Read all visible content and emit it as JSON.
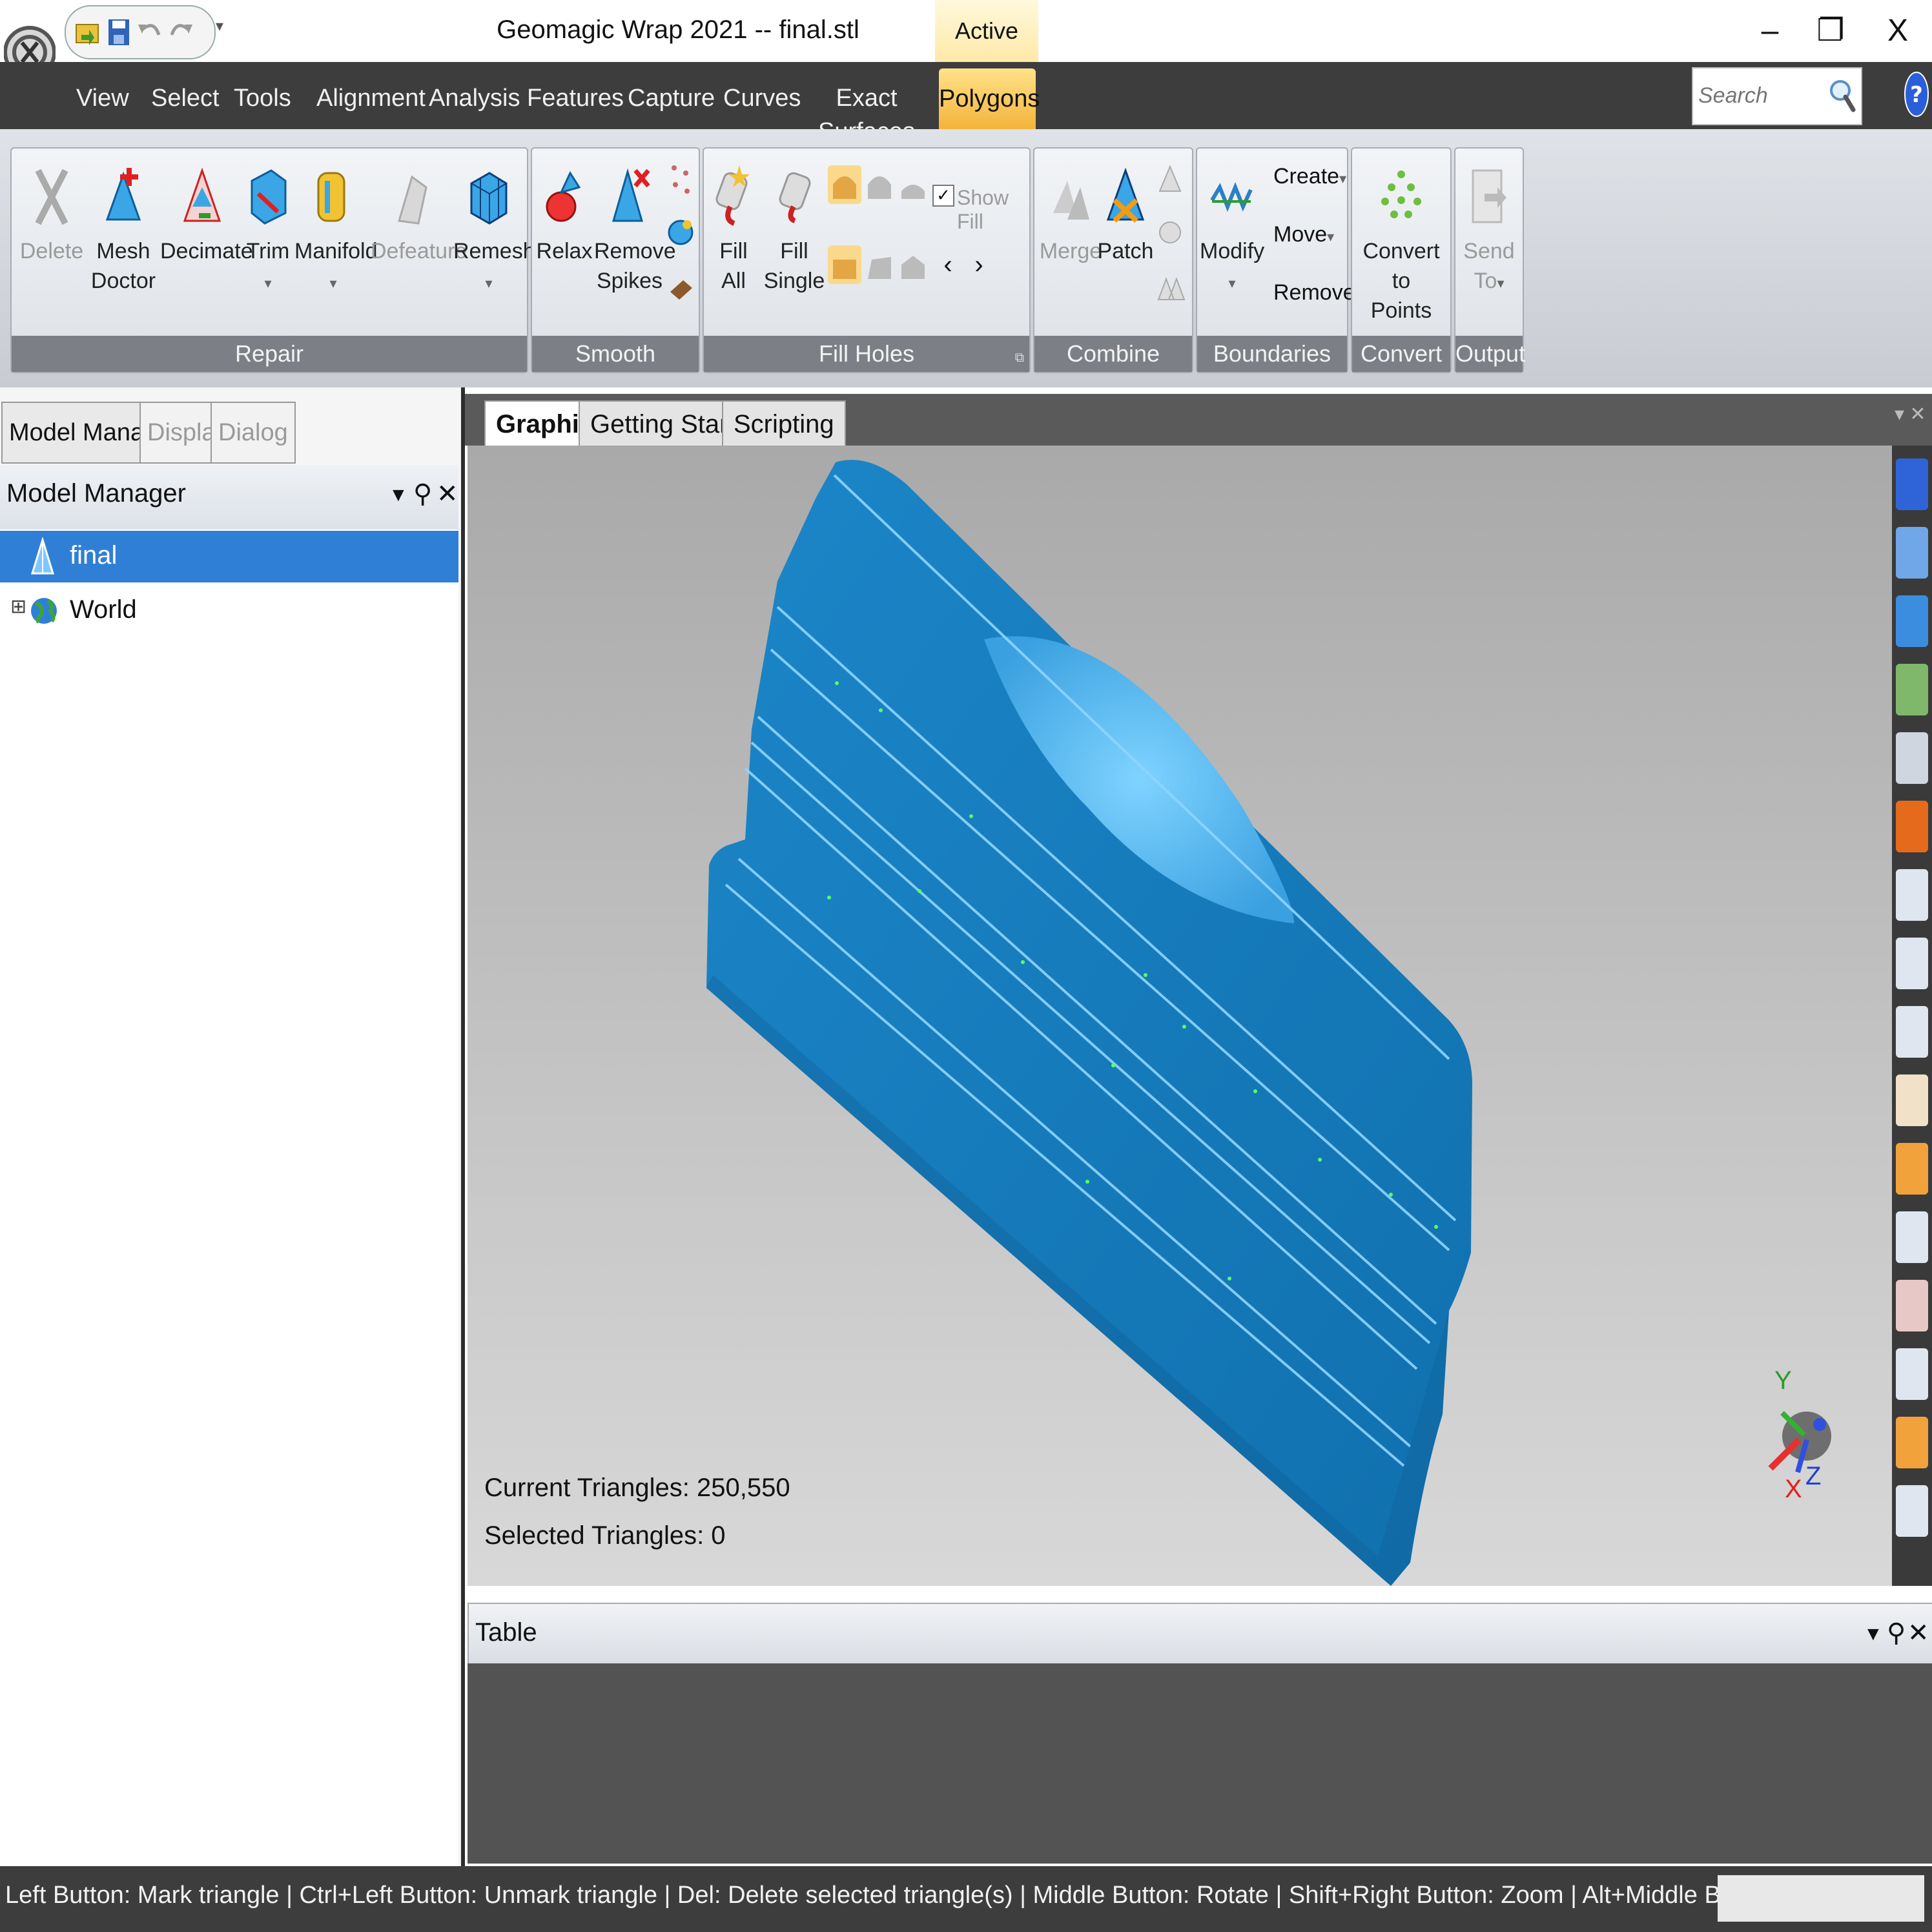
{
  "window": {
    "title": "Geomagic Wrap 2021 -- final.stl",
    "context_label": "Active",
    "minimize": "–",
    "restore": "❐",
    "close": "X"
  },
  "menu": {
    "tabs": [
      "View",
      "Select",
      "Tools",
      "Alignment",
      "Analysis",
      "Features",
      "Capture",
      "Curves",
      "Exact Surfaces",
      "Polygons"
    ],
    "active_tab": "Polygons"
  },
  "search": {
    "placeholder": "Search",
    "value": ""
  },
  "ribbon": {
    "repair": {
      "label": "Repair",
      "delete": "Delete",
      "mesh_doctor_1": "Mesh",
      "mesh_doctor_2": "Doctor",
      "decimate": "Decimate",
      "trim": "Trim",
      "manifold": "Manifold",
      "defeature": "Defeature",
      "remesh": "Remesh"
    },
    "smooth": {
      "label": "Smooth",
      "relax": "Relax",
      "remove_spikes_1": "Remove",
      "remove_spikes_2": "Spikes"
    },
    "fill_holes": {
      "label": "Fill Holes",
      "fill_all_1": "Fill",
      "fill_all_2": "All",
      "fill_single_1": "Fill",
      "fill_single_2": "Single",
      "show_fill": "Show Fill"
    },
    "combine": {
      "label": "Combine",
      "merge": "Merge",
      "patch": "Patch"
    },
    "boundaries": {
      "label": "Boundaries",
      "modify": "Modify",
      "create": "Create",
      "move": "Move",
      "remove": "Remove"
    },
    "convert": {
      "label": "Convert",
      "convert_1": "Convert to",
      "convert_2": "Points"
    },
    "output": {
      "label": "Output",
      "send_1": "Send",
      "send_2": "To"
    }
  },
  "panel": {
    "tabs": [
      "Model Manager",
      "Display",
      "Dialog"
    ],
    "title": "Model Manager",
    "tree": [
      {
        "label": "final",
        "selected": true,
        "icon": "mesh-icon"
      },
      {
        "label": "World",
        "selected": false,
        "icon": "globe-icon",
        "expander": "⊞"
      }
    ]
  },
  "graphics": {
    "tabs": [
      "Graphics",
      "Getting Started",
      "Scripting"
    ],
    "current_triangles": "Current Triangles: 250,550",
    "selected_triangles": "Selected Triangles: 0",
    "axes": {
      "x": "X",
      "y": "Y",
      "z": "Z"
    }
  },
  "table": {
    "title": "Table"
  },
  "status": {
    "text": "Left Button: Mark triangle | Ctrl+Left Button: Unmark triangle | Del: Delete selected triangle(s) | Middle Button: Rotate | Shift+Right Button: Zoom | Alt+Middle Button: Pan"
  },
  "colors": {
    "mesh": "#1f7fc0",
    "mesh_highlight": "#6ec6ff",
    "selection": "#2f7fd6",
    "context_tab": "#f3b43b",
    "menubar": "#3d3d3d"
  }
}
